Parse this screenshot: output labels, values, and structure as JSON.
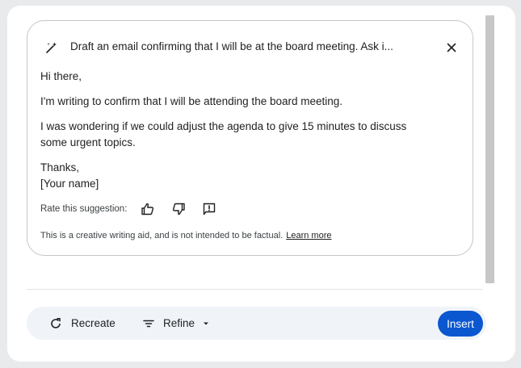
{
  "prompt": {
    "text": "Draft an email confirming that I will be at the board meeting. Ask i...",
    "wand_icon": "magic-wand-icon",
    "close_icon": "close-icon"
  },
  "email": {
    "greeting": "Hi there,",
    "paragraph1": "I'm writing to confirm that I will be attending the board meeting.",
    "paragraph2_line1": "I was wondering if we could adjust the agenda to give 15 minutes to discuss",
    "paragraph2_line2": "some urgent topics.",
    "signoff": "Thanks,",
    "name": "[Your name]"
  },
  "rating": {
    "label": "Rate this suggestion:",
    "icons": [
      "thumbs-up-icon",
      "thumbs-down-icon",
      "report-icon"
    ]
  },
  "disclaimer": {
    "text": "This is a creative writing aid, and is not intended to be factual.",
    "link": "Learn more"
  },
  "actions": {
    "recreate_label": "Recreate",
    "refine_label": "Refine",
    "insert_label": "Insert"
  },
  "colors": {
    "accent": "#0b57d0",
    "action_bar_bg": "#f0f4f9",
    "card_border": "#c4c7c5"
  }
}
